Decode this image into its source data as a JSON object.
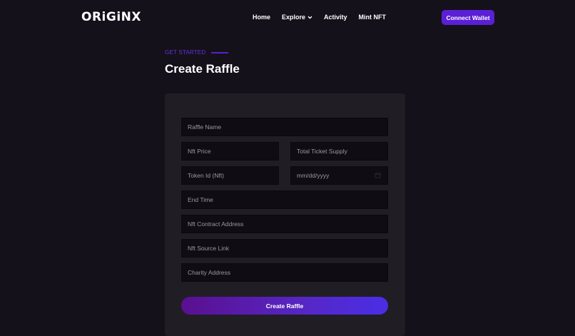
{
  "header": {
    "logo": "ORiGiNX",
    "nav": [
      {
        "label": "Home"
      },
      {
        "label": "Explore"
      },
      {
        "label": "Activity"
      },
      {
        "label": "Mint NFT"
      }
    ],
    "connect_label": "Connect Wallet"
  },
  "main": {
    "eyebrow": "GET STARTED",
    "title": "Create Raffle",
    "form": {
      "raffle_name_placeholder": "Raffle Name",
      "nft_price_placeholder": "Nft Price",
      "total_ticket_supply_placeholder": "Total Ticket Supply",
      "token_id_placeholder": "Token Id (Nft)",
      "date_placeholder": "mm/dd/yyyy",
      "end_time_placeholder": "End Time",
      "nft_contract_address_placeholder": "Nft Contract Address",
      "nft_source_link_placeholder": "Nft Source Link",
      "charity_address_placeholder": "Charity Address",
      "submit_label": "Create Raffle"
    }
  },
  "colors": {
    "background": "#14111a",
    "card": "#201d25",
    "field": "#0f0d13",
    "accent": "#5b1fd6"
  }
}
